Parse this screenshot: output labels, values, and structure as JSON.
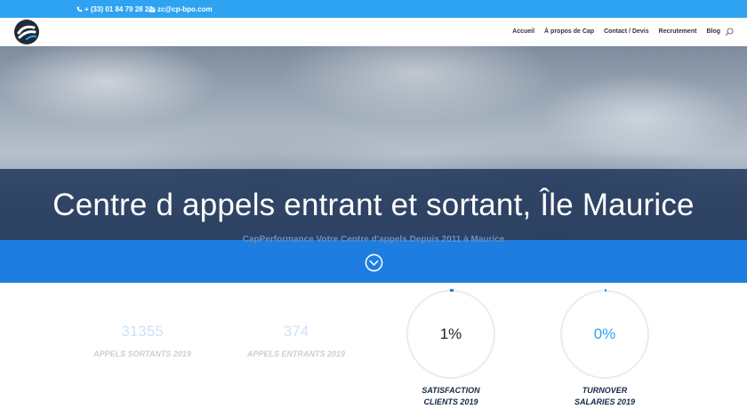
{
  "topbar": {
    "phone": "+ (33) 01 84 79 28 20",
    "email": "zc@cp-bpo.com",
    "phone_icon": "phone-icon",
    "email_icon": "envelope-icon"
  },
  "header": {
    "logo_icon": "capperformance-logo",
    "nav": [
      "Accueil",
      "À propos de Cap",
      "Contact / Devis",
      "Recrutement",
      "Blog"
    ],
    "search_icon": "search-icon"
  },
  "hero": {
    "title": "Centre d appels entrant et sortant, Île Maurice",
    "subtitle": "CapPerformance Votre Centre d'appels Depuis 2011 à Maurice",
    "down_icon": "chevron-down-circle-icon"
  },
  "stats": {
    "counters": [
      {
        "value": "31355",
        "label": "APPELS SORTANTS 2019"
      },
      {
        "value": "374",
        "label": "APPELS ENTRANTS 2019"
      }
    ],
    "rings": [
      {
        "value": "1%",
        "label_line1": "SATISFACTION",
        "label_line2": "CLIENTS 2019"
      },
      {
        "value": "0%",
        "label_line1": "TURNOVER",
        "label_line2": "SALARIES 2019"
      }
    ]
  },
  "colors": {
    "accent": "#2ea3f2",
    "band_blue": "#1e7de0",
    "title_band": "#162d52",
    "label_navy": "#142a47"
  }
}
